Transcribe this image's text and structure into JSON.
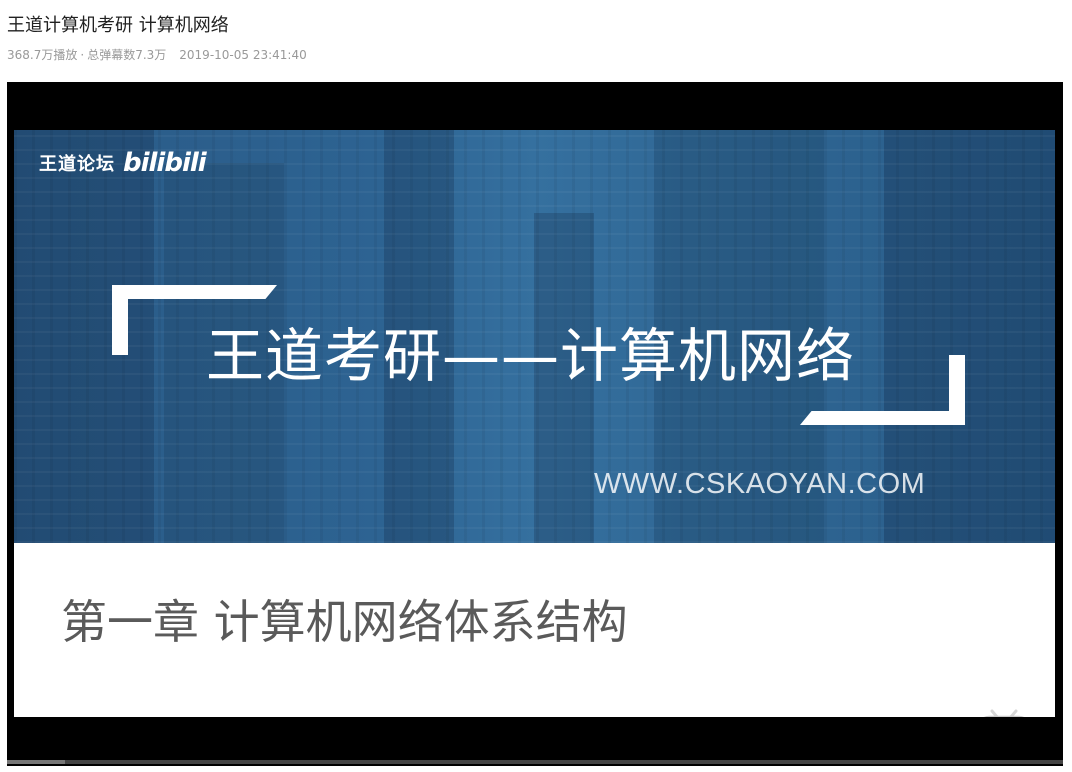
{
  "video": {
    "title": "王道计算机考研 计算机网络",
    "views": "368.7万播放",
    "separator": "·",
    "danmaku": "总弹幕数7.3万",
    "date": "2019-10-05 23:41:40"
  },
  "slide": {
    "logo_text": "王道论坛",
    "logo_brand": "bilibili",
    "main_heading": "王道考研——计算机网络",
    "site_url": "WWW.CSKAOYAN.COM",
    "chapter_title": "第一章 计算机网络体系结构"
  },
  "player": {
    "progress_fraction": 0.055
  },
  "colors": {
    "banner_blue": "#2d6392",
    "chapter_text": "#5a5a5a",
    "player_bg": "#000000"
  },
  "icons": {
    "watermark": "bilibili-tv-icon"
  }
}
